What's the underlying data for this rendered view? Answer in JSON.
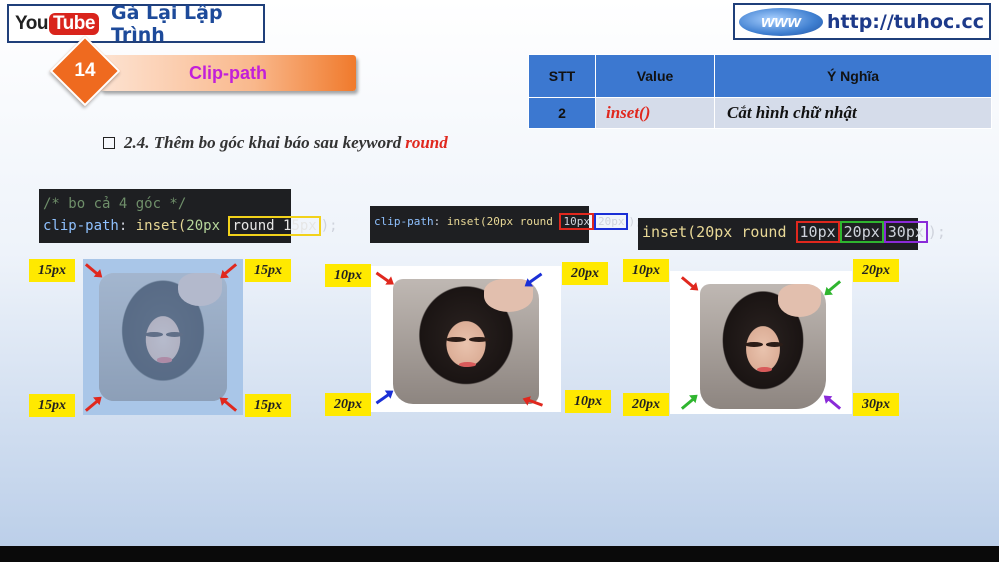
{
  "brand": {
    "you": "You",
    "tube": "Tube",
    "name": "Gà Lại Lập Trình"
  },
  "site": {
    "globe": "www",
    "url": "http://tuhoc.cc"
  },
  "section": {
    "number": "14",
    "title": "Clip-path"
  },
  "table": {
    "headers": [
      "STT",
      "Value",
      "Ý Nghĩa"
    ],
    "row": {
      "stt": "2",
      "value": "inset()",
      "meaning": "Cắt hình chữ nhật"
    }
  },
  "heading": {
    "text": "2.4. Thêm bo góc khai báo sau keyword",
    "keyword": "round"
  },
  "code1": {
    "comment": "/* bo cả 4 góc */",
    "prop": "clip-path",
    "fn": "inset(",
    "arg": "20px",
    "round": "round 15px",
    "end": ");"
  },
  "code2": {
    "prop": "clip-path",
    "fn": "inset(20px round",
    "v1": "10px",
    "v2": "20px",
    "end": ");"
  },
  "code3": {
    "fn": "inset(20px round",
    "v1": "10px",
    "v2": "20px",
    "v3": "30px",
    "end": ");"
  },
  "labels": {
    "ex1": [
      "15px",
      "15px",
      "15px",
      "15px"
    ],
    "ex2": [
      "10px",
      "20px",
      "20px",
      "10px"
    ],
    "ex3": [
      "10px",
      "20px",
      "20px",
      "30px"
    ]
  },
  "colors": {
    "red": "#e0281e",
    "green": "#2fb52f",
    "blue": "#1a2fd6",
    "purple": "#8a2ad8",
    "yellow": "#ffe900"
  }
}
